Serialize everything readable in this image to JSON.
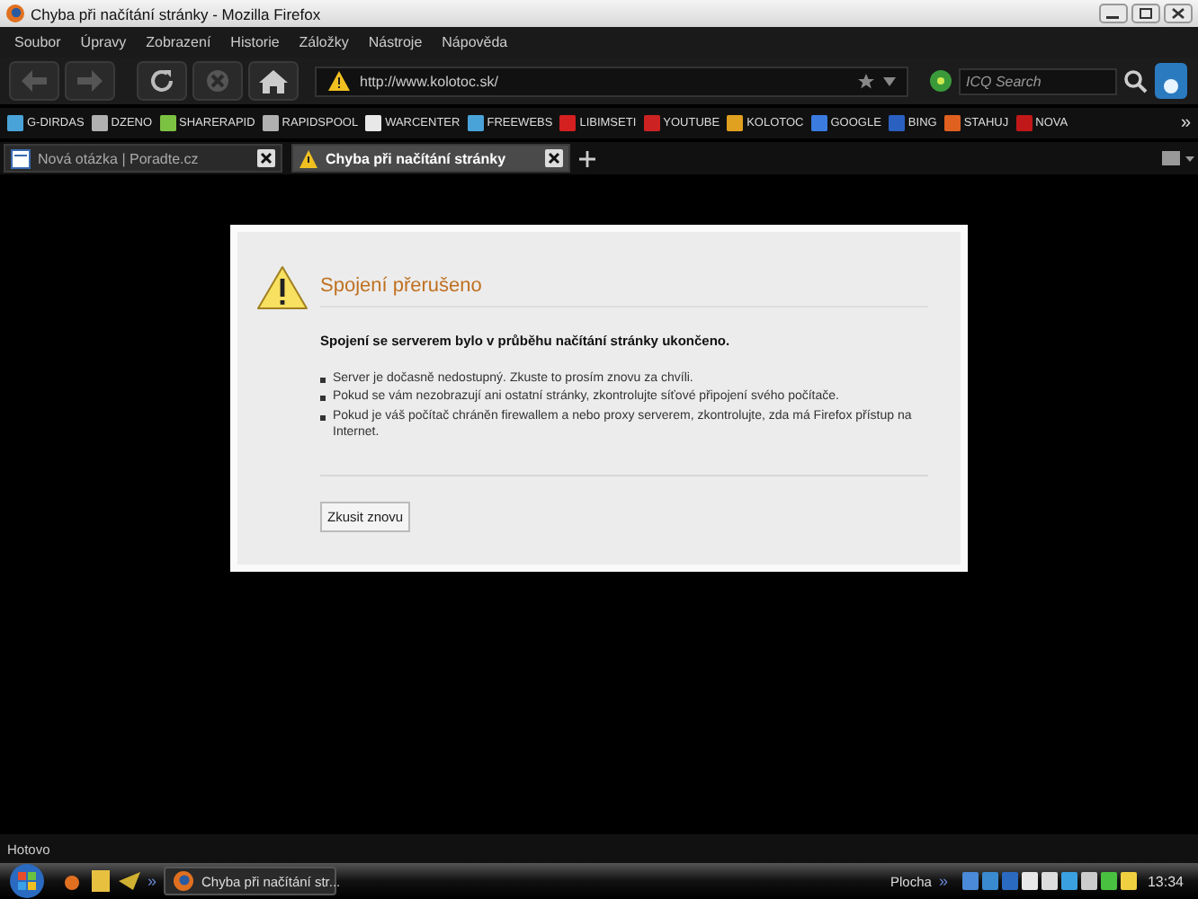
{
  "window": {
    "title": "Chyba při načítání stránky - Mozilla Firefox"
  },
  "menu": [
    "Soubor",
    "Úpravy",
    "Zobrazení",
    "Historie",
    "Záložky",
    "Nástroje",
    "Nápověda"
  ],
  "address_bar": {
    "value": "http://www.kolotoc.sk/"
  },
  "search": {
    "placeholder": "ICQ Search"
  },
  "bookmarks": [
    {
      "label": "G-DIRDAS",
      "color": "#4aa3d8"
    },
    {
      "label": "DZENO",
      "color": "#b0b0b0"
    },
    {
      "label": "SHARERAPID",
      "color": "#7cc242"
    },
    {
      "label": "RAPIDSPOOL",
      "color": "#b0b0b0"
    },
    {
      "label": "WARCENTER",
      "color": "#e8e8e8"
    },
    {
      "label": "FREEWEBS",
      "color": "#4aa3d8"
    },
    {
      "label": "LIBIMSETI",
      "color": "#d42020"
    },
    {
      "label": "YOUTUBE",
      "color": "#cc2222"
    },
    {
      "label": "KOLOTOC",
      "color": "#e0a020"
    },
    {
      "label": "GOOGLE",
      "color": "#3b7be0"
    },
    {
      "label": "BING",
      "color": "#2a60c0"
    },
    {
      "label": "STAHUJ",
      "color": "#e06020"
    },
    {
      "label": "NOVA",
      "color": "#c01818"
    }
  ],
  "bookmarks_more": "»",
  "tabs": [
    {
      "label": "Nová otázka | Poradte.cz",
      "selected": false,
      "kind": "page"
    },
    {
      "label": "Chyba při načítání stránky",
      "selected": true,
      "kind": "warning"
    }
  ],
  "error_page": {
    "title": "Spojení přerušeno",
    "summary": "Spojení se serverem bylo v průběhu načítání stránky ukončeno.",
    "items": [
      "Server je dočasně nedostupný. Zkuste to prosím znovu za chvíli.",
      "Pokud se vám nezobrazují ani ostatní stránky, zkontrolujte síťové připojení svého počítače.",
      "Pokud je váš počítač chráněn firewallem a nebo proxy serverem, zkontrolujte, zda má Firefox přístup na Internet."
    ],
    "button": "Zkusit znovu"
  },
  "status_bar": {
    "text": "Hotovo"
  },
  "taskbar": {
    "quick_launch_more": "»",
    "task": "Chyba při načítání str...",
    "desktop": "Plocha",
    "desktop_more": "»",
    "clock": "13:34"
  }
}
